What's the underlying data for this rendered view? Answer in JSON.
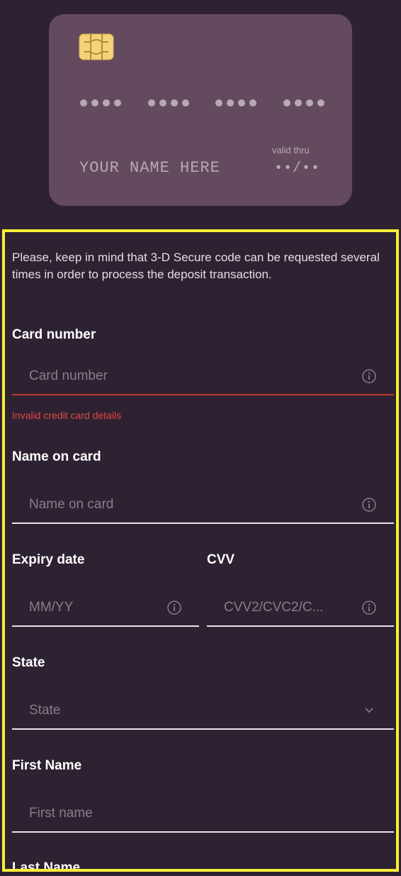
{
  "card_preview": {
    "number_groups": [
      "••••",
      "••••",
      "••••",
      "••••"
    ],
    "name_placeholder": "YOUR NAME HERE",
    "valid_thru_label": "valid thru",
    "expiry_placeholder": "••/••"
  },
  "form": {
    "notice": "Please, keep in mind that 3-D Secure code can be requested several times in order to process the deposit transaction.",
    "card_number": {
      "label": "Card number",
      "placeholder": "Card number",
      "error": "Invalid credit card details"
    },
    "name_on_card": {
      "label": "Name on card",
      "placeholder": "Name on card"
    },
    "expiry": {
      "label": "Expiry date",
      "placeholder": "MM/YY"
    },
    "cvv": {
      "label": "CVV",
      "placeholder": "CVV2/CVC2/C..."
    },
    "state": {
      "label": "State",
      "placeholder": "State"
    },
    "first_name": {
      "label": "First Name",
      "placeholder": "First name"
    },
    "last_name": {
      "label": "Last Name"
    }
  },
  "colors": {
    "background": "#2e2232",
    "card": "#644a5f",
    "chip": "#f4d27a",
    "error": "#e0483f",
    "highlight_border": "#f7ee3a"
  },
  "icons": {
    "field_info": "info-icon",
    "state_dropdown": "chevron-down-icon",
    "card_chip": "card-chip-icon"
  }
}
